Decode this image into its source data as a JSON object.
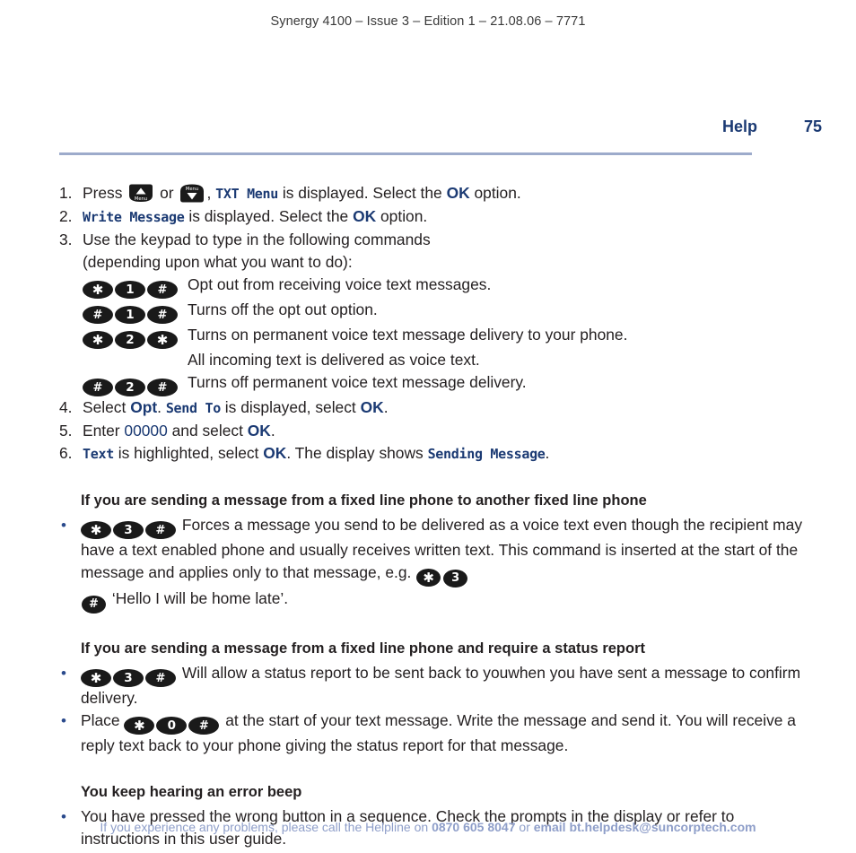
{
  "header": {
    "doc_line": "Synergy 4100 – Issue 3 – Edition 1 – 21.08.06 – 7771",
    "section_label": "Help",
    "page_number": "75"
  },
  "colors": {
    "accent_navy": "#1b3a73",
    "rule": "#9dabcb",
    "key_fill": "#1a1a1a",
    "footer": "#8e9ec9",
    "bullet": "#2a4a8c"
  },
  "steps": [
    {
      "num": "1.",
      "parts": [
        {
          "t": "text",
          "v": "Press "
        },
        {
          "t": "icon",
          "v": "menu-up-button"
        },
        {
          "t": "text",
          "v": " or "
        },
        {
          "t": "icon",
          "v": "menu-down-button"
        },
        {
          "t": "text",
          "v": ", "
        },
        {
          "t": "lcd",
          "v": "TXT Menu"
        },
        {
          "t": "text",
          "v": " is displayed. Select the "
        },
        {
          "t": "bold-blue",
          "v": "OK"
        },
        {
          "t": "text",
          "v": " option."
        }
      ]
    },
    {
      "num": "2.",
      "parts": [
        {
          "t": "lcd",
          "v": "Write Message"
        },
        {
          "t": "text",
          "v": " is displayed. Select the "
        },
        {
          "t": "bold-blue",
          "v": "OK"
        },
        {
          "t": "text",
          "v": " option."
        }
      ]
    },
    {
      "num": "3.",
      "parts": [
        {
          "t": "text",
          "v": "Use the keypad to type in the following commands"
        },
        {
          "t": "break",
          "v": ""
        },
        {
          "t": "text",
          "v": "(depending upon what you want to do):"
        }
      ]
    }
  ],
  "step1": {
    "press": "Press",
    "or": "or",
    "lcd_txt_menu": "TXT Menu",
    "is_displayed_select": "is displayed. Select the",
    "ok": "OK",
    "option": "option."
  },
  "step2": {
    "lcd_write_message": "Write Message",
    "is_displayed_select": "is displayed. Select the",
    "ok": "OK",
    "option": "option."
  },
  "step3": {
    "line1": "Use the keypad to type in the following commands",
    "line2": "(depending upon what you want to do):"
  },
  "commands": [
    {
      "keys": [
        "*",
        "1",
        "#"
      ],
      "desc": "Opt out from receiving voice text messages.",
      "cont": ""
    },
    {
      "keys": [
        "#",
        "1",
        "#"
      ],
      "desc": "Turns off the opt out option.",
      "cont": ""
    },
    {
      "keys": [
        "*",
        "2",
        "*"
      ],
      "desc": "Turns on permanent voice text message delivery to your phone.",
      "cont": "All incoming text is delivered as voice text."
    },
    {
      "keys": [
        "#",
        "2",
        "#"
      ],
      "desc": "Turns off permanent voice text message delivery.",
      "cont": ""
    }
  ],
  "step4": {
    "num": "4.",
    "select": "Select",
    "opt": "Opt",
    "dot": ".",
    "lcd_send_to": "Send To",
    "is_displayed_select": "is displayed, select",
    "ok": "OK",
    "period": "."
  },
  "step5": {
    "num": "5.",
    "enter": "Enter",
    "code": "00000",
    "and_select": "and select",
    "ok": "OK",
    "period": "."
  },
  "step6": {
    "num": "6.",
    "lcd_text": "Text",
    "is_highlighted_select": "is highlighted, select",
    "ok": "OK",
    "display_shows": ". The display shows",
    "lcd_sending_message": "Sending Message",
    "period": "."
  },
  "section_fixedline": {
    "heading": "If you are sending a message from a fixed line phone to another fixed line phone",
    "bullet": {
      "keys": [
        "*",
        "3",
        "#"
      ],
      "text_a": "Forces a message you send to be delivered as a voice text even though the recipient may have a text enabled phone and usually receives written text. This command is inserted at the start of the message and applies only to that message, e.g.",
      "inline_keys_1": [
        "*",
        "3"
      ],
      "inline_keys_2": [
        "#"
      ],
      "text_b": "‘Hello I will be home late’."
    }
  },
  "section_statusreport": {
    "heading": "If you are sending a message from a fixed line phone and require a status report",
    "bullets": [
      {
        "keys": [
          "*",
          "3",
          "#"
        ],
        "text": "Will allow a status report to be sent back to youwhen you have sent a message to confirm delivery."
      },
      {
        "lead": "Place",
        "keys": [
          "*",
          "0",
          "#"
        ],
        "text": "at the start of your text message. Write the message and send it. You will receive a reply text back to your phone giving the status report for that message."
      }
    ]
  },
  "section_errorbeep": {
    "heading": "You keep hearing an error beep",
    "bullets": [
      "You have pressed the wrong button in a sequence. Check the prompts in the display or refer to instructions in this user guide."
    ]
  },
  "footer": {
    "lead": "If you experience any problems, please call the Helpline on ",
    "phone": "0870 605 8047",
    "middle": " or ",
    "email": "email bt.helpdesk@suncorptech.com"
  },
  "icons": {
    "menu_up": "menu-up-button",
    "menu_down": "menu-down-button",
    "menu_label": "Menu"
  }
}
